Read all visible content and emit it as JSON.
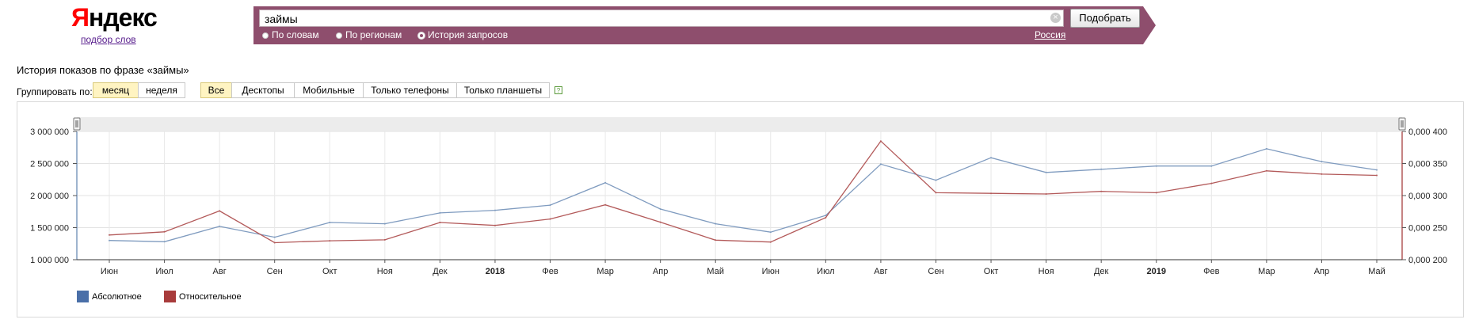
{
  "header": {
    "logo_first": "Я",
    "logo_rest": "ндекс",
    "logo_subtitle": "подбор слов",
    "search_value": "займы",
    "submit_label": "Подобрать",
    "clear_icon": "clear-icon",
    "radios": [
      {
        "label": "По словам",
        "selected": false
      },
      {
        "label": "По регионам",
        "selected": false
      },
      {
        "label": "История запросов",
        "selected": true
      }
    ],
    "region": "Россия"
  },
  "page": {
    "phrase_title": "История показов по фразе «займы»",
    "group_label": "Группировать по:",
    "period_buttons": [
      {
        "label": "месяц",
        "selected": true
      },
      {
        "label": "неделя",
        "selected": false
      }
    ],
    "device_buttons": [
      {
        "label": "Все",
        "selected": true
      },
      {
        "label": "Десктопы",
        "selected": false
      },
      {
        "label": "Мобильные",
        "selected": false
      },
      {
        "label": "Только телефоны",
        "selected": false
      },
      {
        "label": "Только планшеты",
        "selected": false
      }
    ],
    "help_label": "?"
  },
  "chart_data": {
    "type": "line",
    "categories": [
      "Июн",
      "Июл",
      "Авг",
      "Сен",
      "Окт",
      "Ноя",
      "Дек",
      "2018",
      "Фев",
      "Мар",
      "Апр",
      "Май",
      "Июн",
      "Июл",
      "Авг",
      "Сен",
      "Окт",
      "Ноя",
      "Дек",
      "2019",
      "Фев",
      "Мар",
      "Апр",
      "Май"
    ],
    "bold_categories": [
      "2018",
      "2019"
    ],
    "y_left": {
      "ticks": [
        1000000,
        1500000,
        2000000,
        2500000,
        3000000
      ],
      "tick_labels": [
        "1 000 000",
        "1 500 000",
        "2 000 000",
        "2 500 000",
        "3 000 000"
      ],
      "range": [
        1000000,
        3000000
      ]
    },
    "y_right": {
      "ticks": [
        0.2,
        0.25,
        0.3,
        0.35,
        0.4
      ],
      "tick_labels": [
        "0,000 200",
        "0,000 250",
        "0,000 300",
        "0,000 350",
        "0,000 400"
      ],
      "range": [
        0.2,
        0.4
      ]
    },
    "series": [
      {
        "name": "Абсолютное",
        "axis": "left",
        "color": "#7f9bbf",
        "legend_color": "#4a6fa8",
        "values": [
          1300000,
          1280000,
          1520000,
          1350000,
          1580000,
          1560000,
          1730000,
          1770000,
          1850000,
          2200000,
          1790000,
          1560000,
          1430000,
          1690000,
          2490000,
          2240000,
          2590000,
          2360000,
          2410000,
          2460000,
          2460000,
          2730000,
          2530000,
          2400000
        ]
      },
      {
        "name": "Относительное",
        "axis": "right",
        "color": "#b35a5a",
        "legend_color": "#a83b3b",
        "values": [
          0.2385,
          0.2435,
          0.276,
          0.2265,
          0.2295,
          0.231,
          0.258,
          0.2535,
          0.2635,
          0.2855,
          0.2585,
          0.2305,
          0.2275,
          0.2655,
          0.385,
          0.3045,
          0.3035,
          0.3025,
          0.3065,
          0.3045,
          0.319,
          0.3385,
          0.3335,
          0.3315
        ]
      }
    ],
    "grid": true,
    "legend_position": "bottom-left"
  }
}
